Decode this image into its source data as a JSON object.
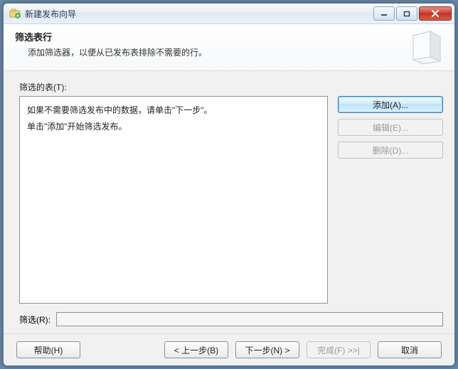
{
  "window": {
    "title": "新建发布向导"
  },
  "header": {
    "title": "筛选表行",
    "subtitle": "添加筛选器，以便从已发布表排除不需要的行。"
  },
  "body": {
    "tables_label": "筛选的表(T):",
    "list_line1": "如果不需要筛选发布中的数据，请单击\"下一步\"。",
    "list_line2": "单击\"添加\"开始筛选发布。",
    "filter_label": "筛选(R):",
    "filter_value": ""
  },
  "side": {
    "add": "添加(A)...",
    "edit": "编辑(E)...",
    "delete": "删除(D)..."
  },
  "footer": {
    "help": "帮助(H)",
    "back": "< 上一步(B)",
    "next": "下一步(N) >",
    "finish": "完成(F) >>|",
    "cancel": "取消"
  }
}
